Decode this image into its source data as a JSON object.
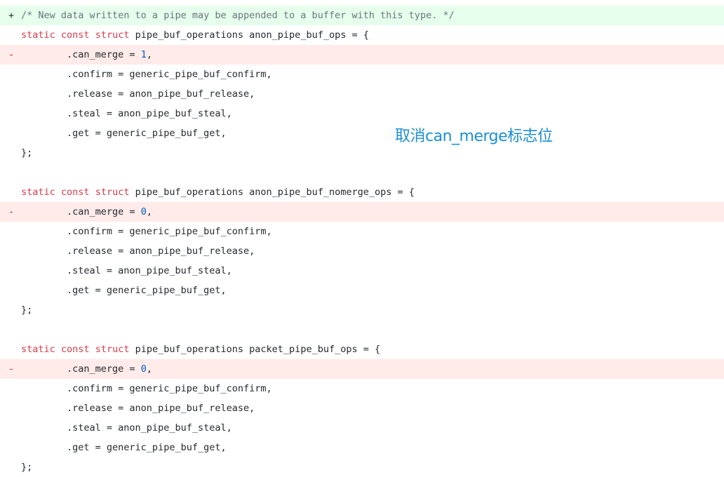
{
  "diff": {
    "lines": [
      {
        "type": "added",
        "marker": "+",
        "tokens": [
          {
            "t": "/* New data written to a pipe may be appended to a buffer with this type. */",
            "c": "comment"
          }
        ]
      },
      {
        "type": "context",
        "marker": "",
        "tokens": [
          {
            "t": "static",
            "c": "kw"
          },
          {
            "t": " "
          },
          {
            "t": "const",
            "c": "kw"
          },
          {
            "t": " "
          },
          {
            "t": "struct",
            "c": "kw"
          },
          {
            "t": " pipe_buf_operations anon_pipe_buf_ops = {"
          }
        ]
      },
      {
        "type": "removed",
        "marker": "-",
        "tokens": [
          {
            "t": "        .can_merge = "
          },
          {
            "t": "1",
            "c": "num"
          },
          {
            "t": ","
          }
        ]
      },
      {
        "type": "context",
        "marker": "",
        "tokens": [
          {
            "t": "        .confirm = generic_pipe_buf_confirm,"
          }
        ]
      },
      {
        "type": "context",
        "marker": "",
        "tokens": [
          {
            "t": "        .release = anon_pipe_buf_release,"
          }
        ]
      },
      {
        "type": "context",
        "marker": "",
        "tokens": [
          {
            "t": "        .steal = anon_pipe_buf_steal,"
          }
        ]
      },
      {
        "type": "context",
        "marker": "",
        "tokens": [
          {
            "t": "        .get = generic_pipe_buf_get,"
          }
        ]
      },
      {
        "type": "context",
        "marker": "",
        "tokens": [
          {
            "t": "};"
          }
        ]
      },
      {
        "type": "context",
        "marker": "",
        "tokens": []
      },
      {
        "type": "context",
        "marker": "",
        "tokens": [
          {
            "t": "static",
            "c": "kw"
          },
          {
            "t": " "
          },
          {
            "t": "const",
            "c": "kw"
          },
          {
            "t": " "
          },
          {
            "t": "struct",
            "c": "kw"
          },
          {
            "t": " pipe_buf_operations anon_pipe_buf_nomerge_ops = {"
          }
        ]
      },
      {
        "type": "removed",
        "marker": "-",
        "tokens": [
          {
            "t": "        .can_merge = "
          },
          {
            "t": "0",
            "c": "num"
          },
          {
            "t": ","
          }
        ]
      },
      {
        "type": "context",
        "marker": "",
        "tokens": [
          {
            "t": "        .confirm = generic_pipe_buf_confirm,"
          }
        ]
      },
      {
        "type": "context",
        "marker": "",
        "tokens": [
          {
            "t": "        .release = anon_pipe_buf_release,"
          }
        ]
      },
      {
        "type": "context",
        "marker": "",
        "tokens": [
          {
            "t": "        .steal = anon_pipe_buf_steal,"
          }
        ]
      },
      {
        "type": "context",
        "marker": "",
        "tokens": [
          {
            "t": "        .get = generic_pipe_buf_get,"
          }
        ]
      },
      {
        "type": "context",
        "marker": "",
        "tokens": [
          {
            "t": "};"
          }
        ]
      },
      {
        "type": "context",
        "marker": "",
        "tokens": []
      },
      {
        "type": "context",
        "marker": "",
        "tokens": [
          {
            "t": "static",
            "c": "kw"
          },
          {
            "t": " "
          },
          {
            "t": "const",
            "c": "kw"
          },
          {
            "t": " "
          },
          {
            "t": "struct",
            "c": "kw"
          },
          {
            "t": " pipe_buf_operations packet_pipe_buf_ops = {"
          }
        ]
      },
      {
        "type": "removed",
        "marker": "-",
        "tokens": [
          {
            "t": "        .can_merge = "
          },
          {
            "t": "0",
            "c": "num"
          },
          {
            "t": ","
          }
        ]
      },
      {
        "type": "context",
        "marker": "",
        "tokens": [
          {
            "t": "        .confirm = generic_pipe_buf_confirm,"
          }
        ]
      },
      {
        "type": "context",
        "marker": "",
        "tokens": [
          {
            "t": "        .release = anon_pipe_buf_release,"
          }
        ]
      },
      {
        "type": "context",
        "marker": "",
        "tokens": [
          {
            "t": "        .steal = anon_pipe_buf_steal,"
          }
        ]
      },
      {
        "type": "context",
        "marker": "",
        "tokens": [
          {
            "t": "        .get = generic_pipe_buf_get,"
          }
        ]
      },
      {
        "type": "context",
        "marker": "",
        "tokens": [
          {
            "t": "};"
          }
        ]
      }
    ]
  },
  "annotation": {
    "text": "取消can_merge标志位"
  }
}
